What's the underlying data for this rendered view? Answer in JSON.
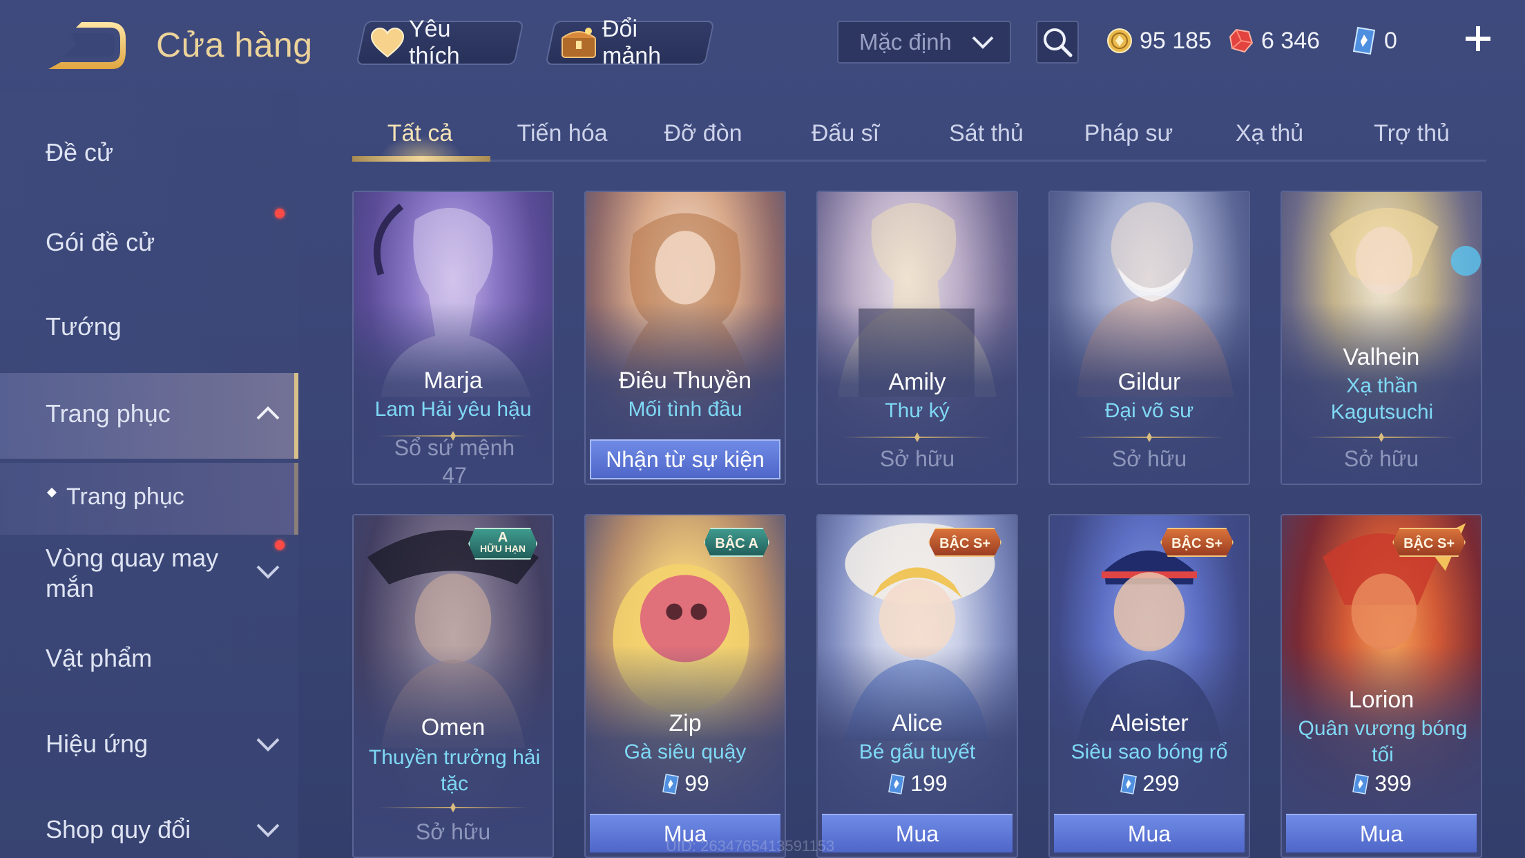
{
  "header": {
    "title": "Cửa hàng",
    "favorites_label": "Yêu thích",
    "exchange_label": "Đổi mảnh",
    "sort_value": "Mặc định",
    "currencies": {
      "gold": "95 185",
      "ruby": "6 346",
      "voucher": "0"
    }
  },
  "sidebar": {
    "items": [
      {
        "label": "Đề cử"
      },
      {
        "label": "Gói đề cử"
      },
      {
        "label": "Tướng"
      },
      {
        "label": "Trang phục"
      },
      {
        "label": "Trang phục"
      },
      {
        "label": "Vòng quay may mắn"
      },
      {
        "label": "Vật phẩm"
      },
      {
        "label": "Hiệu ứng"
      },
      {
        "label": "Shop quy đổi"
      }
    ]
  },
  "tabs": [
    "Tất cả",
    "Tiến hóa",
    "Đỡ đòn",
    "Đấu sĩ",
    "Sát thủ",
    "Pháp sư",
    "Xạ thủ",
    "Trợ thủ"
  ],
  "cards": [
    {
      "hero": "Marja",
      "skin": "Lam Hải yêu hậu",
      "status": "Sổ sứ mệnh 47"
    },
    {
      "hero": "Điêu Thuyền",
      "skin": "Mối tình đầu",
      "action": "Nhận từ sự kiện"
    },
    {
      "hero": "Amily",
      "skin": "Thư ký",
      "status": "Sở hữu"
    },
    {
      "hero": "Gildur",
      "skin": "Đại võ sư",
      "status": "Sở hữu"
    },
    {
      "hero": "Valhein",
      "skin": "Xạ thần Kagutsuchi",
      "status": "Sở hữu"
    },
    {
      "hero": "Omen",
      "skin": "Thuyền trưởng hải tặc",
      "status": "Sở hữu",
      "badge": "A",
      "badge_sub": "HỮU HẠN"
    },
    {
      "hero": "Zip",
      "skin": "Gà siêu quậy",
      "price": "99",
      "buy": "Mua",
      "badge": "BẬC A"
    },
    {
      "hero": "Alice",
      "skin": "Bé gấu tuyết",
      "price": "199",
      "buy": "Mua",
      "badge": "BẬC S+"
    },
    {
      "hero": "Aleister",
      "skin": "Siêu sao bóng rổ",
      "price": "299",
      "buy": "Mua",
      "badge": "BẬC S+"
    },
    {
      "hero": "Lorion",
      "skin": "Quân vương bóng tối",
      "price": "399",
      "buy": "Mua",
      "badge": "BẬC S+"
    }
  ],
  "footer": {
    "uid": "UID: 2634765413591153"
  },
  "colors": {
    "accent_gold": "#ecd39a",
    "skin_name": "#7fd9f5",
    "buy_button": "#5b74d6",
    "notification": "#ff4a45"
  }
}
